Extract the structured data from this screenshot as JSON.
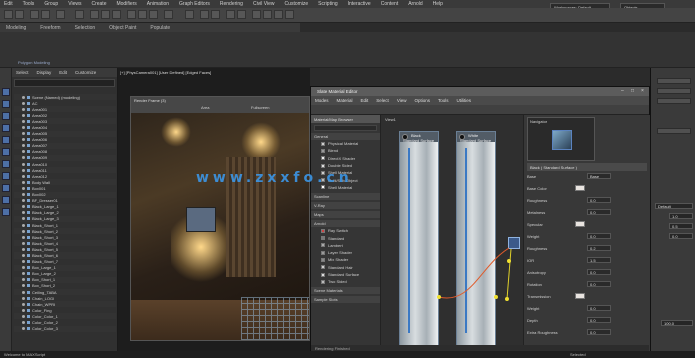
{
  "menu": [
    "Edit",
    "Tools",
    "Group",
    "Views",
    "Create",
    "Modifiers",
    "Animation",
    "Graph Editors",
    "Rendering",
    "Civil View",
    "Customize",
    "Scripting",
    "Interactive",
    "Content",
    "Arnold",
    "Help"
  ],
  "top_right": {
    "workspace": "Workspaces: Default",
    "search": "Objects"
  },
  "ribbon": {
    "tabs": [
      "Modeling",
      "Freeform",
      "Selection",
      "Object Paint",
      "Populate"
    ],
    "sub_label": "Polygon Modeling"
  },
  "scene_explorer": {
    "menu": [
      "Select",
      "Display",
      "Edit",
      "Customize"
    ],
    "items": [
      "Scene (Named) (modeling)",
      "AC",
      "Area001",
      "Area002",
      "Area003",
      "Area004",
      "Area005",
      "Area006",
      "Area007",
      "Area008",
      "Area009",
      "Area010",
      "Area011",
      "Area012",
      "Body Wall",
      "Box001",
      "Box002",
      "BF_Dresser01",
      "Black_Large_1",
      "Black_Large_2",
      "Black_Large_3",
      "Black_Short_1",
      "Black_Short_2",
      "Black_Short_3",
      "Black_Short_4",
      "Black_Short_5",
      "Black_Short_6",
      "Black_Short_7",
      "Box_Large_1",
      "Box_Large_2",
      "Box_Short_1",
      "Box_Short_2",
      "Ceiling_TABA",
      "Chain_LOGI",
      "Chain_WPRI",
      "Color_Fing",
      "Color_Color_1",
      "Color_Color_2",
      "Color_Color_3"
    ]
  },
  "viewport": {
    "label": "[+] [PhysCamera001] [User Defined] [Edged Faces]",
    "render_title": "Render Frame (3)",
    "render_area": "Area",
    "render_val": "Fullscreen"
  },
  "sme": {
    "title": "Slate Material Editor",
    "menu": [
      "Modes",
      "Material",
      "Edit",
      "Select",
      "View",
      "Options",
      "Tools",
      "Utilities"
    ],
    "browser_title": "Material/Map Browser",
    "search_placeholder": "Search by Name ...",
    "categories": [
      "General",
      "Scanline",
      "V-Ray",
      "Maps",
      "Arnold",
      "Scene Materials",
      "Sample Slots"
    ],
    "general_items": [
      "Physical Material",
      "Blend",
      "DirectX Shader",
      "Double Sided",
      "Shell Material",
      "Multi/Sub-Object",
      "Shell Material"
    ],
    "arnold_items": [
      "Ray Switch",
      "Standard",
      "Lambert",
      "Layer Shader",
      "Mix Shader",
      "Standard Hair",
      "Standard Surface",
      "Two Sided"
    ],
    "view_tab": "View1",
    "node1": "Black Standard Surface",
    "node2": "White Standard Surface",
    "nav_label": "Navigator",
    "param_head": "Black ( Standard Surface )",
    "status": "Rendering Finished",
    "params": [
      {
        "label": "Base",
        "value": "Base",
        "n": "0.8"
      },
      {
        "label": "Base Color",
        "value": ""
      },
      {
        "label": "Roughness",
        "value": "0.0"
      },
      {
        "label": "Metalness",
        "value": "0.0"
      },
      {
        "label": "Specular",
        "value": ""
      },
      {
        "label": "Weight",
        "value": "0.0"
      },
      {
        "label": "Roughness",
        "value": "0.2"
      },
      {
        "label": "IOR",
        "value": "1.5"
      },
      {
        "label": "Anisotropy",
        "value": "0.0"
      },
      {
        "label": "Rotation",
        "value": "0.0"
      },
      {
        "label": "Transmission",
        "value": ""
      },
      {
        "label": "Weight",
        "value": "0.0"
      },
      {
        "label": "Depth",
        "value": "0.0"
      },
      {
        "label": "Extra Roughness",
        "value": "0.0"
      }
    ]
  },
  "watermark": "www.zxxfo.cn",
  "right_panel": {
    "fields": [
      "Default",
      "1.0",
      "0.5",
      "0.0",
      "100.0"
    ]
  },
  "bottom": {
    "status": "Welcome to MAXScript",
    "right": "Selected"
  }
}
